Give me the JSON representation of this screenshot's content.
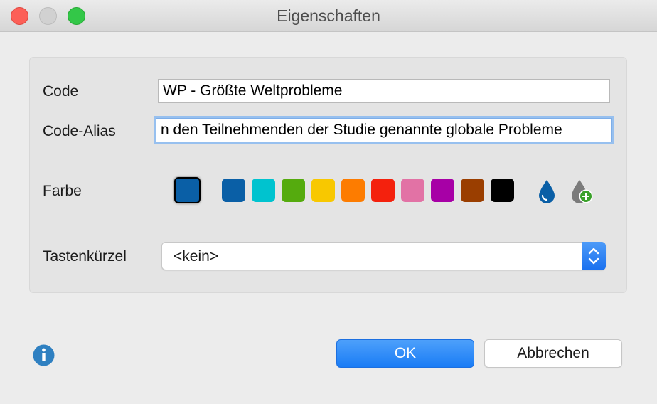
{
  "window": {
    "title": "Eigenschaften"
  },
  "form": {
    "code_label": "Code",
    "code_value": "WP - Größte Weltprobleme",
    "alias_label": "Code-Alias",
    "alias_value": "n den Teilnehmenden der Studie genannte globale Probleme",
    "color_label": "Farbe",
    "shortcut_label": "Tastenkürzel",
    "shortcut_value": "<kein>"
  },
  "colors": {
    "selected": "#0a5fa6",
    "swatches": [
      "#0a5fa6",
      "#00c3cf",
      "#55ab0e",
      "#f8c800",
      "#fd7c00",
      "#f4210d",
      "#e272a5",
      "#a700a6",
      "#9a3e00",
      "#000000"
    ],
    "accent": "#1a7cf5",
    "info": "#2f80c1"
  },
  "icons": {
    "custom_color": "drop-icon",
    "add_color": "drop-plus-icon",
    "info": "info-icon"
  },
  "buttons": {
    "ok_label": "OK",
    "cancel_label": "Abbrechen"
  }
}
